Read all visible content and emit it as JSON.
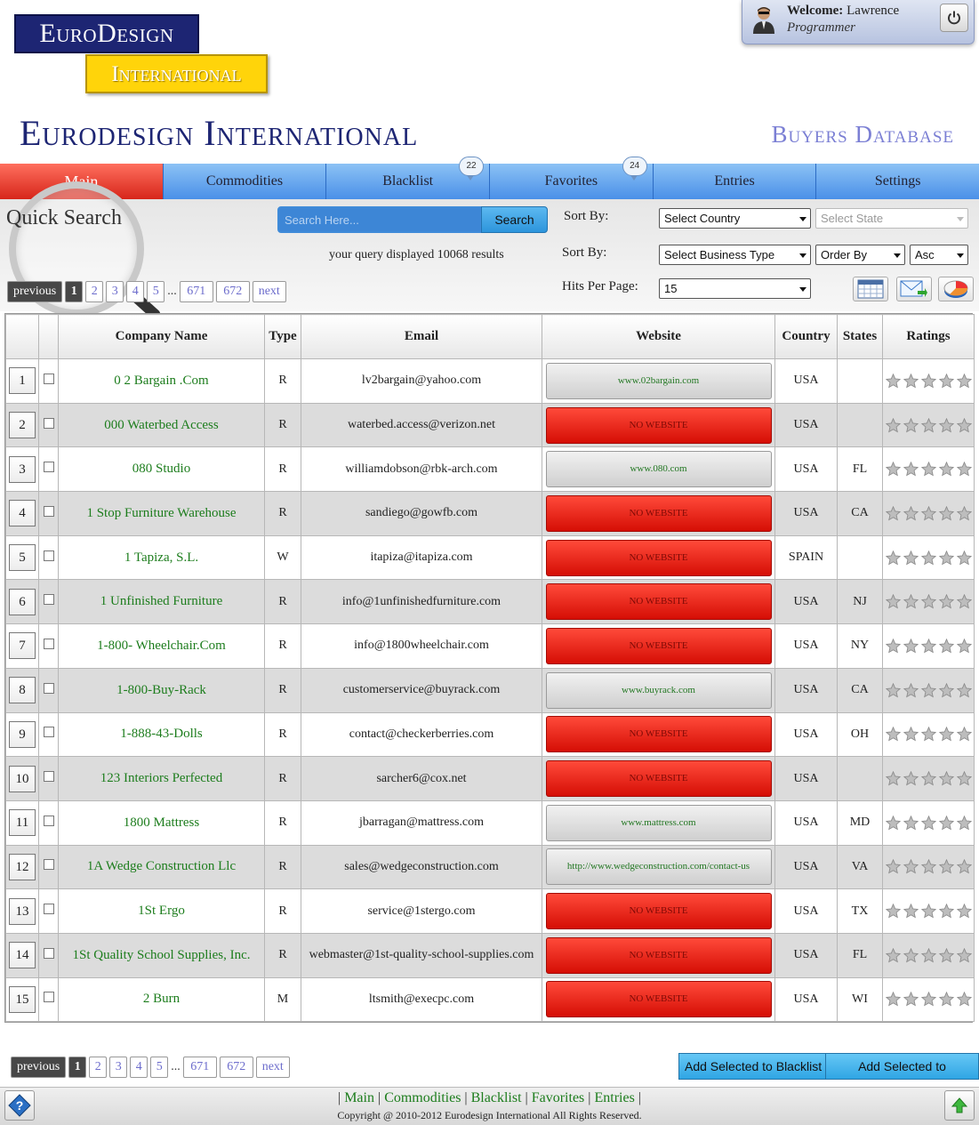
{
  "header": {
    "logo_top": "EuroDesign",
    "logo_bottom": "International",
    "site_title": "Eurodesign International",
    "site_subtitle": "Buyers Database",
    "welcome_label": "Welcome:",
    "user_name": "Lawrence",
    "user_role": "Programmer"
  },
  "nav": {
    "items": [
      {
        "label": "Main"
      },
      {
        "label": "Commodities"
      },
      {
        "label": "Blacklist",
        "badge": "22"
      },
      {
        "label": "Favorites",
        "badge": "24"
      },
      {
        "label": "Entries"
      },
      {
        "label": "Settings"
      }
    ]
  },
  "search": {
    "title": "Quick Search",
    "placeholder": "Search Here...",
    "button": "Search",
    "result_info": "your query displayed 10068 results"
  },
  "filters": {
    "sort_by_label_1": "Sort By:",
    "sort_by_label_2": "Sort By:",
    "hits_label": "Hits Per Page:",
    "country": "Select Country",
    "state": "Select State",
    "business_type": "Select Business Type",
    "order_by": "Order By",
    "direction": "Asc",
    "hits": "15"
  },
  "pagination": {
    "prev": "previous",
    "next": "next",
    "pages": [
      "1",
      "2",
      "3",
      "4",
      "5"
    ],
    "ellipsis": "...",
    "last_pages": [
      "671",
      "672"
    ]
  },
  "table": {
    "headers": {
      "company": "Company Name",
      "type": "Type",
      "email": "Email",
      "website": "Website",
      "country": "Country",
      "states": "States",
      "ratings": "Ratings"
    },
    "rows": [
      {
        "num": "1",
        "company": "0 2 Bargain .Com",
        "type": "R",
        "email": "lv2bargain@yahoo.com",
        "website": "www.02bargain.com",
        "country": "USA",
        "state": ""
      },
      {
        "num": "2",
        "company": "000 Waterbed Access",
        "type": "R",
        "email": "waterbed.access@verizon.net",
        "website": "NO WEBSITE",
        "country": "USA",
        "state": ""
      },
      {
        "num": "3",
        "company": "080 Studio",
        "type": "R",
        "email": "williamdobson@rbk-arch.com",
        "website": "www.080.com",
        "country": "USA",
        "state": "FL"
      },
      {
        "num": "4",
        "company": "1 Stop Furniture Warehouse",
        "type": "R",
        "email": "sandiego@gowfb.com",
        "website": "NO WEBSITE",
        "country": "USA",
        "state": "CA"
      },
      {
        "num": "5",
        "company": "1 Tapiza, S.L.",
        "type": "W",
        "email": "itapiza@itapiza.com",
        "website": "NO WEBSITE",
        "country": "SPAIN",
        "state": ""
      },
      {
        "num": "6",
        "company": "1 Unfinished Furniture",
        "type": "R",
        "email": "info@1unfinishedfurniture.com",
        "website": "NO WEBSITE",
        "country": "USA",
        "state": "NJ"
      },
      {
        "num": "7",
        "company": "1-800- Wheelchair.Com",
        "type": "R",
        "email": "info@1800wheelchair.com",
        "website": "NO WEBSITE",
        "country": "USA",
        "state": "NY"
      },
      {
        "num": "8",
        "company": "1-800-Buy-Rack",
        "type": "R",
        "email": "customerservice@buyrack.com",
        "website": "www.buyrack.com",
        "country": "USA",
        "state": "CA"
      },
      {
        "num": "9",
        "company": "1-888-43-Dolls",
        "type": "R",
        "email": "contact@checkerberries.com",
        "website": "NO WEBSITE",
        "country": "USA",
        "state": "OH"
      },
      {
        "num": "10",
        "company": "123 Interiors Perfected",
        "type": "R",
        "email": "sarcher6@cox.net",
        "website": "NO WEBSITE",
        "country": "USA",
        "state": ""
      },
      {
        "num": "11",
        "company": "1800 Mattress",
        "type": "R",
        "email": "jbarragan@mattress.com",
        "website": "www.mattress.com",
        "country": "USA",
        "state": "MD"
      },
      {
        "num": "12",
        "company": "1A Wedge Construction Llc",
        "type": "R",
        "email": "sales@wedgeconstruction.com",
        "website": "http://www.wedgeconstruction.com/contact-us",
        "country": "USA",
        "state": "VA"
      },
      {
        "num": "13",
        "company": "1St Ergo",
        "type": "R",
        "email": "service@1stergo.com",
        "website": "NO WEBSITE",
        "country": "USA",
        "state": "TX"
      },
      {
        "num": "14",
        "company": "1St Quality School Supplies, Inc.",
        "type": "R",
        "email": "webmaster@1st-quality-school-supplies.com",
        "website": "NO WEBSITE",
        "country": "USA",
        "state": "FL"
      },
      {
        "num": "15",
        "company": "2 Burn",
        "type": "M",
        "email": "ltsmith@execpc.com",
        "website": "NO WEBSITE",
        "country": "USA",
        "state": "WI"
      }
    ]
  },
  "actions": {
    "blacklist": "Add Selected to Blacklist",
    "favorites": "Add Selected to Favorites"
  },
  "footer": {
    "links": [
      "Main",
      "Commodities",
      "Blacklist",
      "Favorites",
      "Entries"
    ],
    "separator": "|",
    "copyright": "Copyright @ 2010-2012 Eurodesign International All Rights Reserved."
  },
  "icons": {
    "avatar": "user-avatar-icon",
    "power": "power-icon",
    "calendar": "calendar-icon",
    "email": "email-forward-icon",
    "chart": "pie-chart-icon",
    "help": "help-icon",
    "up": "arrow-up-icon",
    "star": "star-icon"
  },
  "colors": {
    "nav_blue": "#4a90e8",
    "nav_active_red": "#d7261a",
    "company_green": "#1d7d1d",
    "no_website_red": "#d50e05",
    "logo_navy": "#1d2573",
    "logo_yellow": "#ffd40a"
  }
}
